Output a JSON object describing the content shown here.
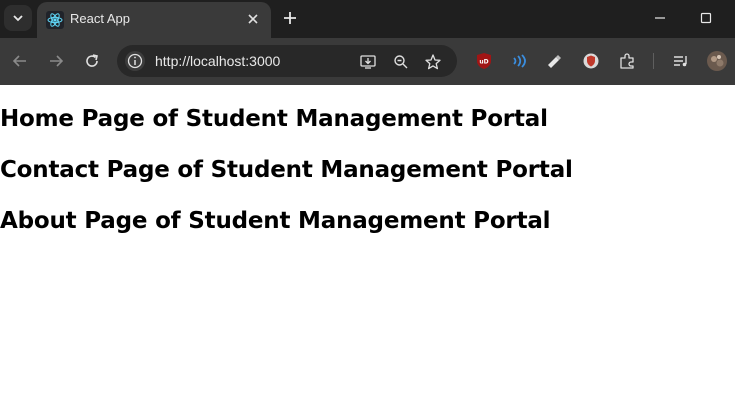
{
  "browser": {
    "tab_title": "React App",
    "url": "http://localhost:3000"
  },
  "page": {
    "headings": [
      "Home Page of Student Management Portal",
      "Contact Page of Student Management Portal",
      "About Page of Student Management Portal"
    ]
  },
  "colors": {
    "tabbar_bg": "#1f1f1f",
    "toolbar_bg": "#3a3a3a",
    "omnibox_bg": "#282828",
    "react_blue": "#61dafb"
  },
  "icons": {
    "tab_list": "chevron-down-icon",
    "favicon": "react-logo-icon",
    "tab_close": "close-icon",
    "new_tab": "plus-icon",
    "minimize": "minimize-icon",
    "maximize": "maximize-icon",
    "back": "back-arrow-icon",
    "forward": "forward-arrow-icon",
    "reload": "reload-icon",
    "site_info": "info-icon",
    "install": "install-app-icon",
    "zoom": "zoom-icon",
    "bookmark": "star-icon",
    "extensions": [
      "ublock-icon",
      "extension-wave-icon",
      "extension-pen-icon",
      "extension-shield-icon",
      "puzzle-icon",
      "media-queue-icon",
      "profile-avatar-icon"
    ]
  }
}
